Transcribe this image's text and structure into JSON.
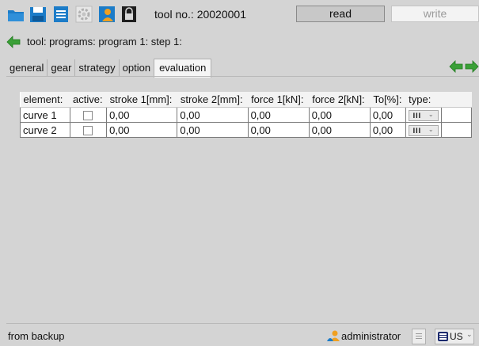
{
  "toolbar": {
    "icons": [
      "folder-icon",
      "save-icon",
      "print-icon",
      "gear-icon",
      "user-icon",
      "lock-icon"
    ],
    "tool_label": "tool no.: 20020001",
    "read_label": "read",
    "write_label": "write"
  },
  "breadcrumb": {
    "text": "tool: programs: program 1: step 1:"
  },
  "tabs": [
    {
      "label": "general"
    },
    {
      "label": "gear"
    },
    {
      "label": "strategy"
    },
    {
      "label": "option"
    },
    {
      "label": "evaluation",
      "active": true
    }
  ],
  "table": {
    "headers": [
      "element:",
      "active:",
      "stroke 1[mm]:",
      "stroke 2[mm]:",
      "force 1[kN]:",
      "force 2[kN]:",
      "To[%]:",
      "type:"
    ],
    "rows": [
      {
        "element": "curve 1",
        "active": false,
        "stroke1": "0,00",
        "stroke2": "0,00",
        "force1": "0,00",
        "force2": "0,00",
        "to": "0,00",
        "type": "III"
      },
      {
        "element": "curve 2",
        "active": false,
        "stroke1": "0,00",
        "stroke2": "0,00",
        "force1": "0,00",
        "force2": "0,00",
        "to": "0,00",
        "type": "III"
      }
    ]
  },
  "status": {
    "text": "from backup",
    "user": "administrator",
    "language": "US"
  },
  "colors": {
    "background": "#d4d4d4",
    "accent_green": "#3aa037",
    "accent_orange": "#f0a020",
    "icon_blue": "#1a78c8"
  }
}
